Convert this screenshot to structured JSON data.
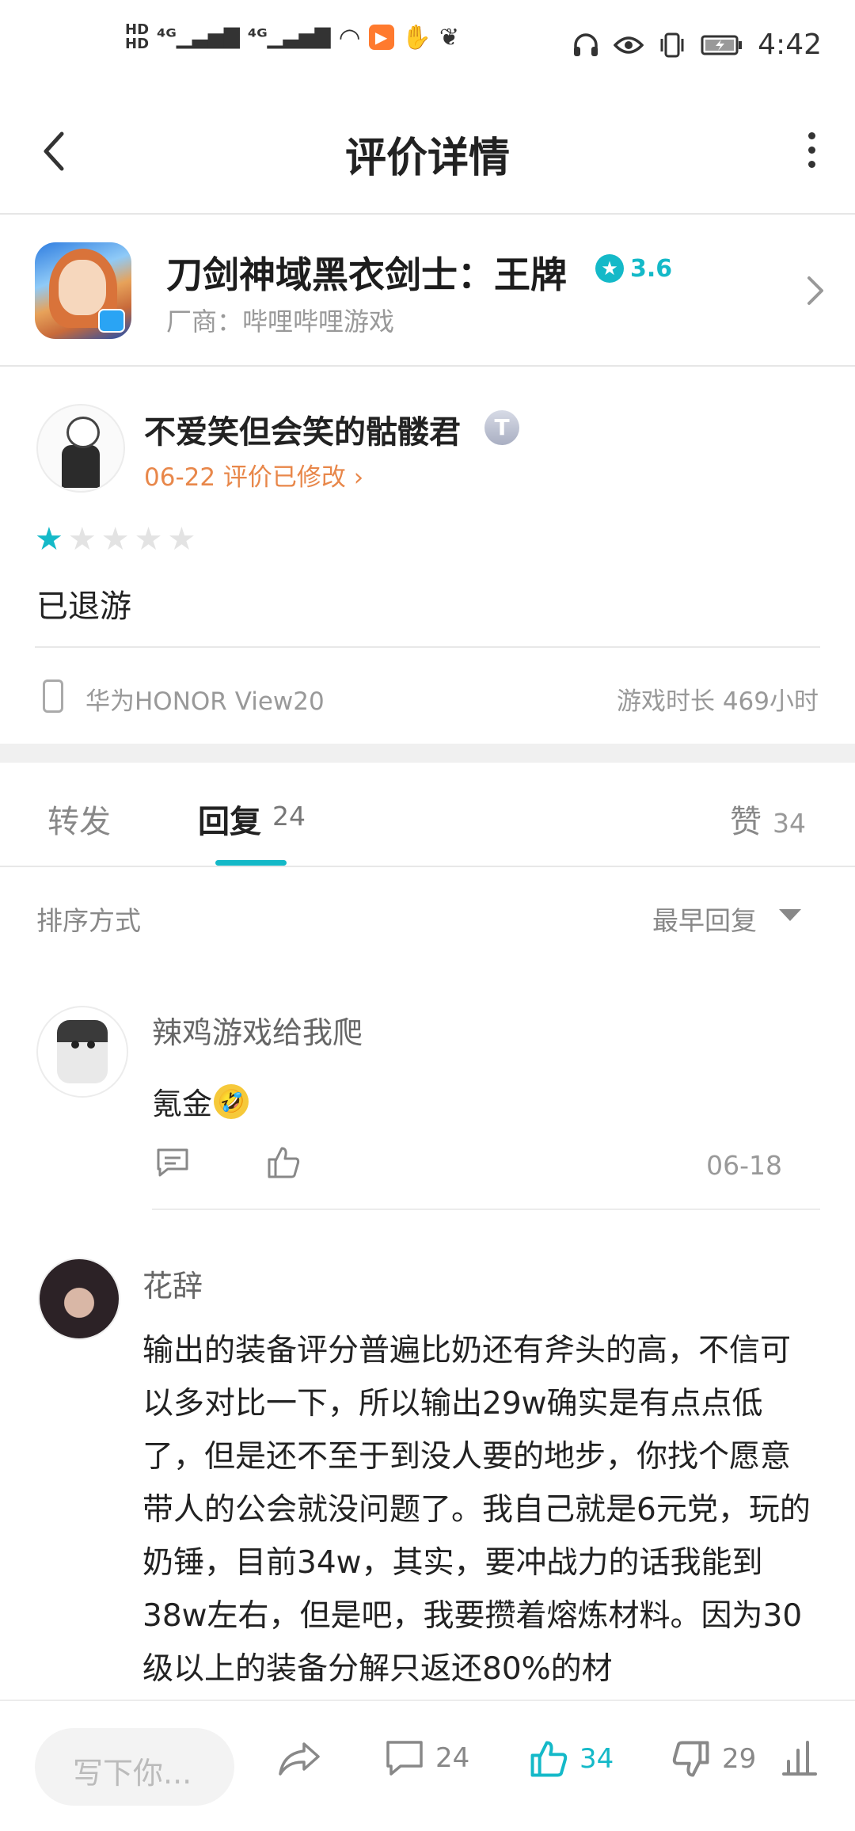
{
  "status_bar": {
    "time": "4:42",
    "left_icons": [
      "hd-1",
      "hd-2",
      "4g-signal-1",
      "4g-signal-2",
      "wifi-icon",
      "play-app-icon",
      "hand-app-icon",
      "squirrel-app-icon"
    ],
    "right_icons": [
      "headphones-icon",
      "eye-icon",
      "vibrate-icon",
      "battery-icon"
    ]
  },
  "header": {
    "title": "评价详情",
    "back_icon": "chevron-left-icon",
    "more_icon": "more-vertical-icon"
  },
  "game": {
    "name": "刀剑神域黑衣剑士：王牌",
    "rating": "3.6",
    "vendor": "厂商：哔哩哔哩游戏",
    "accent": "#14b9c8"
  },
  "review": {
    "user": "不爱笑但会笑的骷髅君",
    "badge": "T",
    "date_label": "06-22 评价已修改",
    "stars_filled": 1,
    "stars_total": 5,
    "text": "已退游",
    "device": "华为HONOR View20",
    "playtime": "游戏时长 469小时"
  },
  "tabs": {
    "forward": "转发",
    "reply": "回复",
    "reply_count": "24",
    "like": "赞",
    "like_count": "34",
    "active": "reply"
  },
  "sort": {
    "label": "排序方式",
    "value": "最早回复"
  },
  "comments": [
    {
      "user": "辣鸡游戏给我爬",
      "text": "氪金",
      "emoji": "🤣",
      "date": "06-18"
    },
    {
      "user": "花辞",
      "text": "输出的装备评分普遍比奶还有斧头的高，不信可以多对比一下，所以输出29w确实是有点点低了，但是还不至于到没人要的地步，你找个愿意带人的公会就没问题了。我自己就是6元党，玩的奶锤，目前34w，其实，要冲战力的话我能到38w左右，但是吧，我要攒着熔炼材料。因为30级以上的装备分解只返还80%的材"
    }
  ],
  "bottom_bar": {
    "write_placeholder": "写下你...",
    "comment_count": "24",
    "like_count": "34",
    "dislike_count": "29"
  }
}
